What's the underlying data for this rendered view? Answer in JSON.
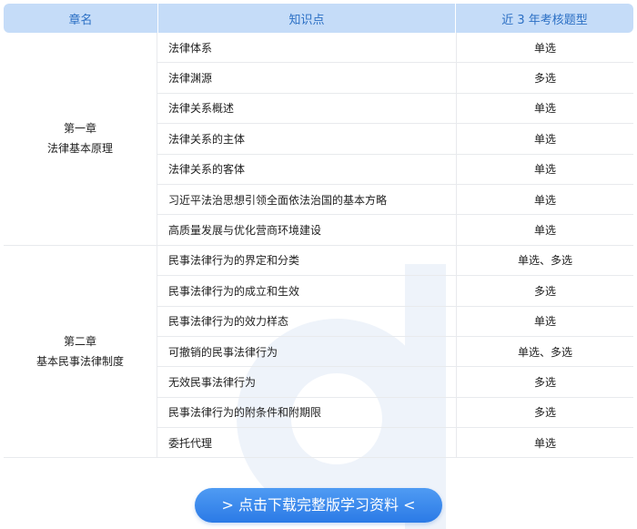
{
  "header": {
    "col_chapter": "章名",
    "col_topic": "知识点",
    "col_qtype": "近 3 年考核题型"
  },
  "chapters": [
    {
      "line1": "第一章",
      "line2": "法律基本原理",
      "rows": [
        {
          "topic": "法律体系",
          "qtype": "单选"
        },
        {
          "topic": "法律渊源",
          "qtype": "多选"
        },
        {
          "topic": "法律关系概述",
          "qtype": "单选"
        },
        {
          "topic": "法律关系的主体",
          "qtype": "单选"
        },
        {
          "topic": "法律关系的客体",
          "qtype": "单选"
        },
        {
          "topic": "习近平法治思想引领全面依法治国的基本方略",
          "qtype": "单选"
        },
        {
          "topic": "高质量发展与优化营商环境建设",
          "qtype": "单选"
        }
      ]
    },
    {
      "line1": "第二章",
      "line2": "基本民事法律制度",
      "rows": [
        {
          "topic": "民事法律行为的界定和分类",
          "qtype": "单选、多选"
        },
        {
          "topic": "民事法律行为的成立和生效",
          "qtype": "多选"
        },
        {
          "topic": "民事法律行为的效力样态",
          "qtype": "单选"
        },
        {
          "topic": "可撤销的民事法律行为",
          "qtype": "单选、多选"
        },
        {
          "topic": "无效民事法律行为",
          "qtype": "多选"
        },
        {
          "topic": "民事法律行为的附条件和附期限",
          "qtype": "多选"
        },
        {
          "topic": "委托代理",
          "qtype": "单选"
        }
      ]
    }
  ],
  "cta": {
    "label": "> 点击下载完整版学习资料 <"
  },
  "colors": {
    "header_bg": "#c5dcf8",
    "header_text": "#2b6fc4",
    "button": "#3a87ee"
  }
}
